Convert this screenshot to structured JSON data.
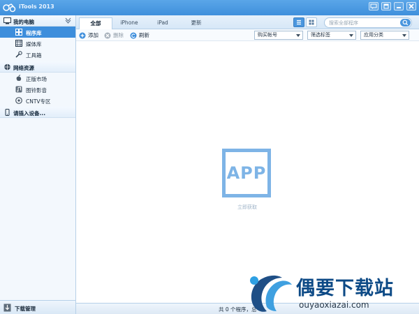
{
  "window": {
    "title": "iTools 2013",
    "controls": [
      "feedback-icon",
      "restore-icon",
      "minimize-icon",
      "close-icon"
    ]
  },
  "sidebar": {
    "sections": [
      {
        "label": "我的电脑",
        "icon": "monitor-icon"
      },
      {
        "label": "网络资源",
        "icon": "globe-icon"
      },
      {
        "label": "请插入设备...",
        "icon": "phone-icon"
      }
    ],
    "items": [
      {
        "label": "程序库",
        "icon": "grid-icon",
        "active": true
      },
      {
        "label": "媒体库",
        "icon": "media-icon",
        "active": false
      },
      {
        "label": "工具箱",
        "icon": "tools-icon",
        "active": false
      },
      {
        "label": "正版市场",
        "icon": "apple-icon",
        "active": false
      },
      {
        "label": "图铃影音",
        "icon": "music-icon",
        "active": false
      },
      {
        "label": "CNTV专区",
        "icon": "tv-icon",
        "active": false
      }
    ],
    "footer": {
      "label": "下载管理",
      "icon": "download-icon"
    }
  },
  "tabs": [
    {
      "label": "全部",
      "active": true
    },
    {
      "label": "iPhone",
      "active": false
    },
    {
      "label": "iPad",
      "active": false
    },
    {
      "label": "更新",
      "active": false
    }
  ],
  "view_toggle": {
    "selected": "list",
    "options": [
      "list-view-icon",
      "grid-view-icon"
    ]
  },
  "search": {
    "placeholder": "搜索全部程序",
    "icon": "search-icon"
  },
  "toolbar": {
    "add_label": "添加",
    "delete_label": "删除",
    "refresh_label": "刷新",
    "dropdowns": [
      "购买帐号",
      "筛选标签",
      "应用分类"
    ]
  },
  "main": {
    "placeholder_text": "APP",
    "get_link": "立即获取"
  },
  "status": {
    "text": "共 0 个程序，总"
  },
  "watermark": {
    "title": "偶要下载站",
    "url": "ouyaoxiazai.com"
  },
  "colors": {
    "accent": "#3d8edc",
    "titlebar": "#4a96de",
    "sidebar_bg": "#f3f8fd",
    "placeholder": "#7eb4e6"
  }
}
